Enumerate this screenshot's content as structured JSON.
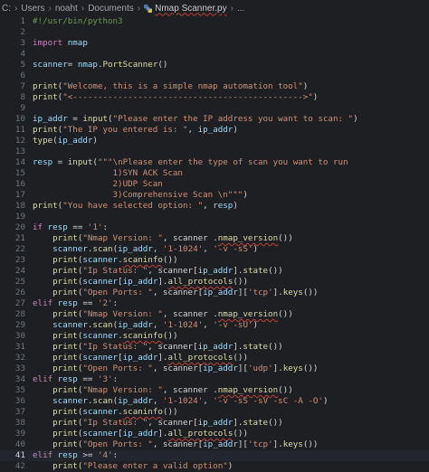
{
  "breadcrumb": {
    "items": [
      "C:",
      "Users",
      "noaht",
      "Documents"
    ],
    "file": "Nmap Scanner.py",
    "more": "..."
  },
  "editor": {
    "active_line": 41,
    "lines": [
      {
        "n": "1",
        "tokens": [
          [
            "cm",
            "#!/usr/bin/python3"
          ]
        ]
      },
      {
        "n": "2",
        "tokens": []
      },
      {
        "n": "3",
        "tokens": [
          [
            "kw",
            "import "
          ],
          [
            "var",
            "nmap"
          ]
        ]
      },
      {
        "n": "4",
        "tokens": []
      },
      {
        "n": "5",
        "tokens": [
          [
            "var",
            "scanner"
          ],
          [
            "",
            "="
          ],
          [
            "var",
            " nmap"
          ],
          [
            "",
            "."
          ],
          [
            "fn",
            "PortScanner"
          ],
          [
            "",
            "()"
          ]
        ]
      },
      {
        "n": "6",
        "tokens": []
      },
      {
        "n": "7",
        "tokens": [
          [
            "fn",
            "print"
          ],
          [
            "",
            "("
          ],
          [
            "str",
            "\"Welcome, this is a simple nmap automation tool\""
          ],
          [
            "",
            ")"
          ]
        ]
      },
      {
        "n": "8",
        "tokens": [
          [
            "fn",
            "print"
          ],
          [
            "",
            "("
          ],
          [
            "str",
            "\"<---------------------------------------------->\""
          ],
          [
            "",
            ")"
          ]
        ]
      },
      {
        "n": "9",
        "tokens": []
      },
      {
        "n": "10",
        "tokens": [
          [
            "var",
            "ip_addr"
          ],
          [
            "",
            " = "
          ],
          [
            "fn",
            "input"
          ],
          [
            "",
            "("
          ],
          [
            "str",
            "\"Please enter the IP address you want to scan: \""
          ],
          [
            "",
            ")"
          ]
        ]
      },
      {
        "n": "11",
        "tokens": [
          [
            "fn",
            "print"
          ],
          [
            "",
            "("
          ],
          [
            "str",
            "\"The IP you entered is: \""
          ],
          [
            "",
            ", "
          ],
          [
            "var",
            "ip_addr"
          ],
          [
            "",
            ")"
          ]
        ]
      },
      {
        "n": "12",
        "tokens": [
          [
            "fn",
            "type"
          ],
          [
            "",
            "("
          ],
          [
            "var",
            "ip_addr"
          ],
          [
            "",
            ")"
          ]
        ]
      },
      {
        "n": "13",
        "tokens": []
      },
      {
        "n": "14",
        "tokens": [
          [
            "var",
            "resp"
          ],
          [
            "",
            " = "
          ],
          [
            "fn",
            "input"
          ],
          [
            "",
            "("
          ],
          [
            "str",
            "\"\"\"\\nPlease enter the type of scan you want to run"
          ]
        ]
      },
      {
        "n": "15",
        "tokens": [
          [
            "str",
            "                1)SYN ACK Scan"
          ]
        ]
      },
      {
        "n": "16",
        "tokens": [
          [
            "str",
            "                2)UDP Scan"
          ]
        ]
      },
      {
        "n": "17",
        "tokens": [
          [
            "str",
            "                3)Comprehensive Scan \\n\"\"\""
          ],
          [
            "",
            ")"
          ]
        ]
      },
      {
        "n": "18",
        "tokens": [
          [
            "fn",
            "print"
          ],
          [
            "",
            "("
          ],
          [
            "str",
            "\"You have selected option: \""
          ],
          [
            "",
            ", "
          ],
          [
            "var",
            "resp"
          ],
          [
            "",
            ")"
          ]
        ]
      },
      {
        "n": "19",
        "tokens": []
      },
      {
        "n": "20",
        "tokens": [
          [
            "kw",
            "if "
          ],
          [
            "var",
            "resp"
          ],
          [
            "",
            " == "
          ],
          [
            "str",
            "'1'"
          ],
          [
            "",
            ":"
          ]
        ]
      },
      {
        "n": "21",
        "tokens": [
          [
            "",
            "    "
          ],
          [
            "fn",
            "print"
          ],
          [
            "",
            "("
          ],
          [
            "str",
            "\"Nmap Version: \""
          ],
          [
            "",
            ", scanner ."
          ],
          [
            "fn",
            "nmap_version"
          ],
          [
            "",
            "())"
          ]
        ]
      },
      {
        "n": "22",
        "tokens": [
          [
            "",
            "    "
          ],
          [
            "var",
            "scanner"
          ],
          [
            "",
            "."
          ],
          [
            "fn",
            "scan"
          ],
          [
            "",
            "("
          ],
          [
            "var",
            "ip_addr"
          ],
          [
            "",
            ", "
          ],
          [
            "str",
            "'1-1024'"
          ],
          [
            "",
            ", "
          ],
          [
            "str",
            "'-v -sS'"
          ],
          [
            "",
            ")"
          ]
        ]
      },
      {
        "n": "23",
        "tokens": [
          [
            "",
            "    "
          ],
          [
            "fn",
            "print"
          ],
          [
            "",
            "("
          ],
          [
            "var",
            "scanner"
          ],
          [
            "",
            "."
          ],
          [
            "fn",
            "scaninfo"
          ],
          [
            "",
            "())"
          ]
        ]
      },
      {
        "n": "24",
        "tokens": [
          [
            "",
            "    "
          ],
          [
            "fn",
            "print"
          ],
          [
            "",
            "("
          ],
          [
            "str",
            "\"Ip Status: \""
          ],
          [
            "",
            ", scanner["
          ],
          [
            "var",
            "ip_addr"
          ],
          [
            "",
            "]."
          ],
          [
            "fn",
            "state"
          ],
          [
            "",
            "())"
          ]
        ]
      },
      {
        "n": "25",
        "tokens": [
          [
            "",
            "    "
          ],
          [
            "fn",
            "print"
          ],
          [
            "",
            "("
          ],
          [
            "var",
            "scanner"
          ],
          [
            "",
            "["
          ],
          [
            "var",
            "ip_addr"
          ],
          [
            "",
            "]."
          ],
          [
            "fn",
            "all_protocols"
          ],
          [
            "",
            "())"
          ]
        ]
      },
      {
        "n": "26",
        "tokens": [
          [
            "",
            "    "
          ],
          [
            "fn",
            "print"
          ],
          [
            "",
            "("
          ],
          [
            "str",
            "\"Open Ports: \""
          ],
          [
            "",
            ", scanner["
          ],
          [
            "var",
            "ip_addr"
          ],
          [
            "",
            "]["
          ],
          [
            "str",
            "'tcp'"
          ],
          [
            "",
            "]."
          ],
          [
            "fn",
            "keys"
          ],
          [
            "",
            "())"
          ]
        ]
      },
      {
        "n": "27",
        "tokens": [
          [
            "kw",
            "elif "
          ],
          [
            "var",
            "resp"
          ],
          [
            "",
            " == "
          ],
          [
            "str",
            "'2'"
          ],
          [
            "",
            ":"
          ]
        ]
      },
      {
        "n": "28",
        "tokens": [
          [
            "",
            "    "
          ],
          [
            "fn",
            "print"
          ],
          [
            "",
            "("
          ],
          [
            "str",
            "\"Nmap Version: \""
          ],
          [
            "",
            ", scanner ."
          ],
          [
            "fn",
            "nmap_version"
          ],
          [
            "",
            "())"
          ]
        ]
      },
      {
        "n": "29",
        "tokens": [
          [
            "",
            "    "
          ],
          [
            "var",
            "scanner"
          ],
          [
            "",
            "."
          ],
          [
            "fn",
            "scan"
          ],
          [
            "",
            "("
          ],
          [
            "var",
            "ip_addr"
          ],
          [
            "",
            ", "
          ],
          [
            "str",
            "'1-1024'"
          ],
          [
            "",
            ", "
          ],
          [
            "str",
            "'-v -sU'"
          ],
          [
            "",
            ")"
          ]
        ]
      },
      {
        "n": "30",
        "tokens": [
          [
            "",
            "    "
          ],
          [
            "fn",
            "print"
          ],
          [
            "",
            "("
          ],
          [
            "var",
            "scanner"
          ],
          [
            "",
            "."
          ],
          [
            "fn",
            "scaninfo"
          ],
          [
            "",
            "())"
          ]
        ]
      },
      {
        "n": "31",
        "tokens": [
          [
            "",
            "    "
          ],
          [
            "fn",
            "print"
          ],
          [
            "",
            "("
          ],
          [
            "str",
            "\"Ip Status: \""
          ],
          [
            "",
            ", scanner["
          ],
          [
            "var",
            "ip_addr"
          ],
          [
            "",
            "]."
          ],
          [
            "fn",
            "state"
          ],
          [
            "",
            "())"
          ]
        ]
      },
      {
        "n": "32",
        "tokens": [
          [
            "",
            "    "
          ],
          [
            "fn",
            "print"
          ],
          [
            "",
            "("
          ],
          [
            "var",
            "scanner"
          ],
          [
            "",
            "["
          ],
          [
            "var",
            "ip_addr"
          ],
          [
            "",
            "]."
          ],
          [
            "fn",
            "all_protocols"
          ],
          [
            "",
            "())"
          ]
        ]
      },
      {
        "n": "33",
        "tokens": [
          [
            "",
            "    "
          ],
          [
            "fn",
            "print"
          ],
          [
            "",
            "("
          ],
          [
            "str",
            "\"Open Ports: \""
          ],
          [
            "",
            ", scanner["
          ],
          [
            "var",
            "ip_addr"
          ],
          [
            "",
            "]["
          ],
          [
            "str",
            "'udp'"
          ],
          [
            "",
            "]."
          ],
          [
            "fn",
            "keys"
          ],
          [
            "",
            "())"
          ]
        ]
      },
      {
        "n": "34",
        "tokens": [
          [
            "kw",
            "elif "
          ],
          [
            "var",
            "resp"
          ],
          [
            "",
            " == "
          ],
          [
            "str",
            "'3'"
          ],
          [
            "",
            ":"
          ]
        ]
      },
      {
        "n": "35",
        "tokens": [
          [
            "",
            "    "
          ],
          [
            "fn",
            "print"
          ],
          [
            "",
            "("
          ],
          [
            "str",
            "\"Nmap Version: \""
          ],
          [
            "",
            ", scanner ."
          ],
          [
            "fn",
            "nmap_version"
          ],
          [
            "",
            "())"
          ]
        ]
      },
      {
        "n": "36",
        "tokens": [
          [
            "",
            "    "
          ],
          [
            "var",
            "scanner"
          ],
          [
            "",
            "."
          ],
          [
            "fn",
            "scan"
          ],
          [
            "",
            "("
          ],
          [
            "var",
            "ip_addr"
          ],
          [
            "",
            ", "
          ],
          [
            "str",
            "'1-1024'"
          ],
          [
            "",
            ", "
          ],
          [
            "str",
            "'-v -sS -sV -sC -A -O'"
          ],
          [
            "",
            ")"
          ]
        ]
      },
      {
        "n": "37",
        "tokens": [
          [
            "",
            "    "
          ],
          [
            "fn",
            "print"
          ],
          [
            "",
            "("
          ],
          [
            "var",
            "scanner"
          ],
          [
            "",
            "."
          ],
          [
            "fn",
            "scaninfo"
          ],
          [
            "",
            "())"
          ]
        ]
      },
      {
        "n": "38",
        "tokens": [
          [
            "",
            "    "
          ],
          [
            "fn",
            "print"
          ],
          [
            "",
            "("
          ],
          [
            "str",
            "\"Ip Status: \""
          ],
          [
            "",
            ", scanner["
          ],
          [
            "var",
            "ip_addr"
          ],
          [
            "",
            "]."
          ],
          [
            "fn",
            "state"
          ],
          [
            "",
            "())"
          ]
        ]
      },
      {
        "n": "39",
        "tokens": [
          [
            "",
            "    "
          ],
          [
            "fn",
            "print"
          ],
          [
            "",
            "("
          ],
          [
            "var",
            "scanner"
          ],
          [
            "",
            "["
          ],
          [
            "var",
            "ip_addr"
          ],
          [
            "",
            "]."
          ],
          [
            "fn",
            "all_protocols"
          ],
          [
            "",
            "())"
          ]
        ]
      },
      {
        "n": "40",
        "tokens": [
          [
            "",
            "    "
          ],
          [
            "fn",
            "print"
          ],
          [
            "",
            "("
          ],
          [
            "str",
            "\"Open Ports: \""
          ],
          [
            "",
            ", scanner["
          ],
          [
            "var",
            "ip_addr"
          ],
          [
            "",
            "]["
          ],
          [
            "str",
            "'tcp'"
          ],
          [
            "",
            "]."
          ],
          [
            "fn",
            "keys"
          ],
          [
            "",
            "())"
          ]
        ]
      },
      {
        "n": "41",
        "tokens": [
          [
            "kw",
            "elif "
          ],
          [
            "var",
            "resp"
          ],
          [
            "",
            " >= "
          ],
          [
            "str",
            "'4'"
          ],
          [
            "",
            ":"
          ]
        ]
      },
      {
        "n": "42",
        "tokens": [
          [
            "",
            "    "
          ],
          [
            "fn",
            "print"
          ],
          [
            "",
            "("
          ],
          [
            "str",
            "\"Please enter a valid option\""
          ],
          [
            "",
            ")"
          ]
        ]
      }
    ]
  },
  "colors": {
    "background": "#1e1f22",
    "keyword": "#c586c0",
    "function": "#dcdcaa",
    "string": "#ce9178",
    "comment": "#6a9955",
    "variable": "#9cdcfe"
  },
  "icons": {
    "file_icon": "python-file-icon",
    "separator": "chevron-right-icon"
  }
}
